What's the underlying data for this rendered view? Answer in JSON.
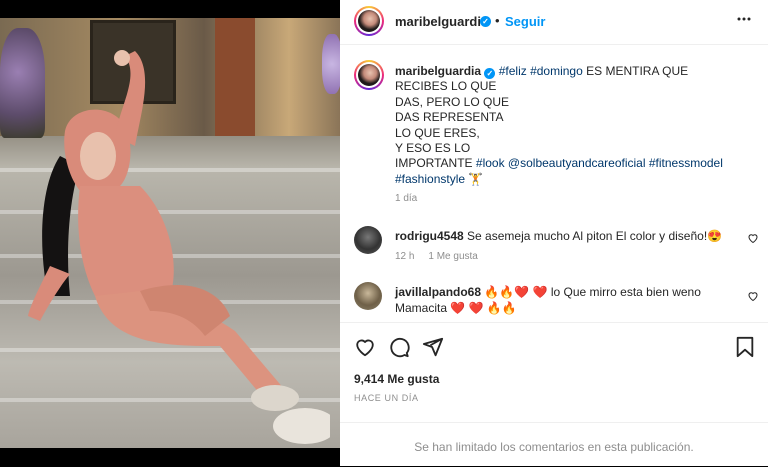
{
  "post": {
    "username": "maribelguardia",
    "follow_label": "Seguir",
    "dot": "•",
    "more_label": "•••",
    "verified_mark": "✓",
    "caption": {
      "username": "maribelguardia",
      "line1_tags": "#feliz #domingo",
      "line1_rest": " ES MENTIRA QUE",
      "line2": "RECIBES LO QUE",
      "line3": "DAS, PERO LO QUE",
      "line4": "DAS REPRESENTA",
      "line5": "LO QUE ERES,",
      "line6": "Y ESO ES LO",
      "line7_text": "IMPORTANTE ",
      "line7_tags": "#look @solbeautyandcareoficial #fitnessmodel",
      "line8_tags": "#fashionstyle",
      "emoji": "🏋"
    },
    "caption_time": "1 día",
    "comments": [
      {
        "username": "rodrigu4548",
        "text": " Se asemeja mucho Al piton El color y diseño!😍",
        "time": "12 h",
        "likes": "1 Me gusta"
      },
      {
        "username": "javillalpando68",
        "text": " 🔥🔥❤️ ❤️ lo Que mirro esta bien weno",
        "text_line2": "Mamacita ❤️ ❤️ 🔥🔥"
      }
    ],
    "likes_count": "9,414 Me gusta",
    "posted_ago": "HACE UN DÍA",
    "comments_limited": "Se han limitado los comentarios en esta publicación."
  },
  "colors": {
    "accent_blue": "#0095f6",
    "tag_blue": "#00376b",
    "muted": "#8e8e8e",
    "text": "#262626"
  },
  "icons": [
    "heart-icon",
    "comment-icon",
    "share-icon",
    "bookmark-icon",
    "more-icon",
    "verified-icon",
    "small-heart-icon"
  ]
}
